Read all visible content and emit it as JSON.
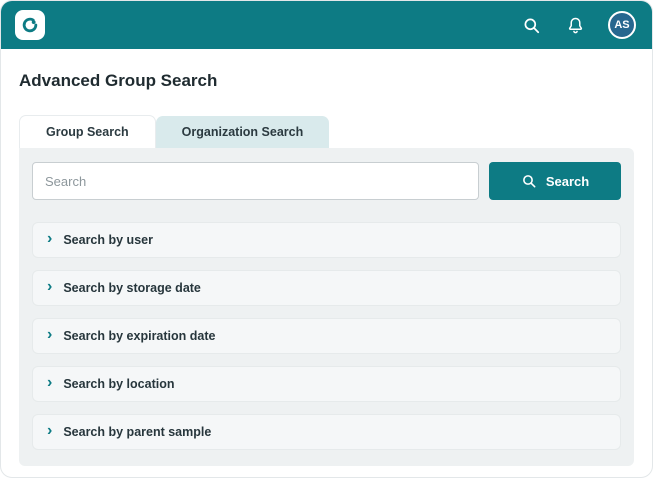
{
  "header": {
    "avatar_initials": "AS"
  },
  "page": {
    "title": "Advanced Group Search"
  },
  "tabs": [
    {
      "label": "Group Search",
      "active": true
    },
    {
      "label": "Organization Search",
      "active": false
    }
  ],
  "search": {
    "placeholder": "Search",
    "button_label": "Search"
  },
  "accordion": {
    "items": [
      {
        "label": "Search by user"
      },
      {
        "label": "Search by storage date"
      },
      {
        "label": "Search by expiration date"
      },
      {
        "label": "Search by location"
      },
      {
        "label": "Search by parent sample"
      }
    ]
  },
  "icons": {
    "logo": "app-logo-swirl",
    "topbar": [
      "search-icon",
      "bell-icon"
    ],
    "button": "search-icon",
    "accordion": "chevron-right-icon"
  },
  "colors": {
    "accent_teal": "#0d7b84",
    "avatar_bg": "#27678f",
    "tab_inactive_bg": "#d9eaec",
    "panel_bg": "#eef1f2",
    "row_bg": "#f5f7f8"
  }
}
